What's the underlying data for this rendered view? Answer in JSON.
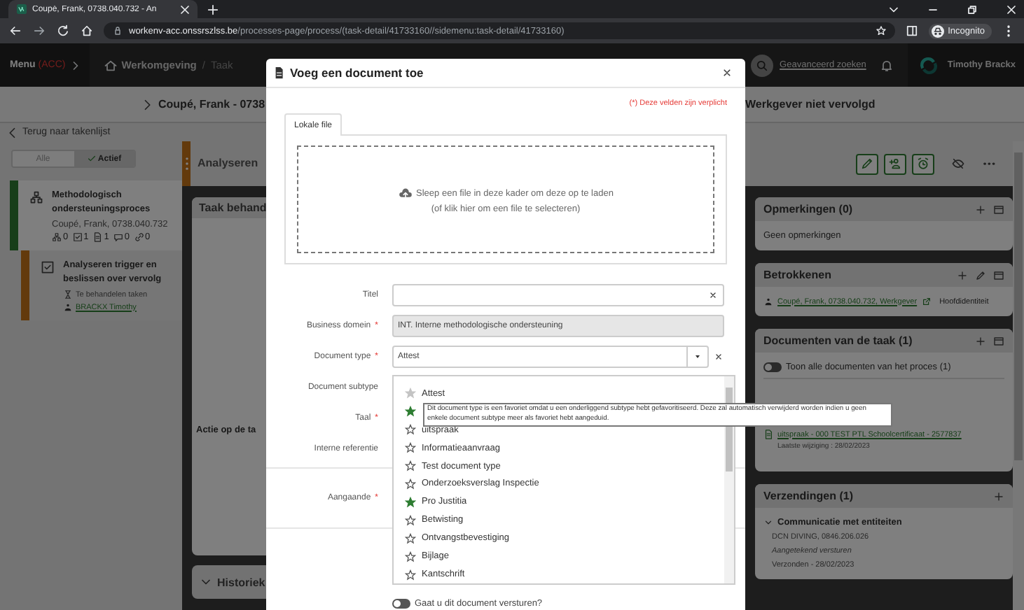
{
  "browser": {
    "tab_title": "Coupé, Frank, 0738.040.732 - An",
    "url_host": "workenv-acc.onssrszlss.be",
    "url_path": "/processes-page/process/(task-detail/41733160//sidemenu:task-detail/41733160)",
    "profile": "Incognito"
  },
  "app_header": {
    "menu": "Menu",
    "env": "(ACC)",
    "breadcrumbs": [
      {
        "label": "Werkomgeving"
      },
      {
        "label": "Taak"
      }
    ],
    "separator": "/",
    "advanced_search": "Geavanceerd zoeken",
    "user": "Timothy Brackx"
  },
  "title_bar": {
    "left": "Coupé, Frank - 0738",
    "right": "Werkgever niet vervolgd"
  },
  "back_link": "Terug naar takenlijst",
  "filter": [
    {
      "label": "Alle",
      "selected": false
    },
    {
      "label": "Actief",
      "selected": true
    }
  ],
  "process": {
    "title": "Methodologisch ondersteuningsproces",
    "subtitle": "Coupé, Frank, 0738.040.732",
    "counts": [
      {
        "kind": "hierarchy",
        "value": "0"
      },
      {
        "kind": "check",
        "value": "1"
      },
      {
        "kind": "document",
        "value": "1"
      },
      {
        "kind": "comment",
        "value": "0"
      },
      {
        "kind": "link",
        "value": "0"
      }
    ]
  },
  "task": {
    "title": "Analyseren trigger en beslissen over vervolg",
    "status": "Te behandelen taken",
    "assignee": "BRACKX Timothy"
  },
  "middle": {
    "header": "Analyseren",
    "section": "Taak behand",
    "action": "Actie op de ta",
    "history": "Historiek"
  },
  "panels": [
    {
      "kind": "remarks",
      "title": "Opmerkingen (0)",
      "empty": "Geen opmerkingen"
    },
    {
      "kind": "involved",
      "title": "Betrokkenen",
      "link": "Coupé, Frank, 0738.040.732, Werkgever",
      "role": "Hoofdidentiteit"
    },
    {
      "kind": "documents",
      "title": "Documenten van de taak (1)",
      "toggle": {
        "label": "Toon alle documenten van het proces (1)",
        "on": false
      },
      "document": "uitspraak - 000 TEST PTL Schoolcertificaat - 2577837",
      "modified": "Laatste wijziging : 28/02/2023"
    },
    {
      "kind": "shipments",
      "title": "Verzendingen (1)",
      "group": "Communicatie met entiteiten",
      "recipient": "DCN DIVING, 0846.206.026",
      "method": "Aangetekend versturen",
      "sent": "Verzonden - 28/02/2023"
    }
  ],
  "modal": {
    "title": "Voeg een document toe",
    "required_note": "(*) Deze velden zijn verplicht",
    "required_mark": "*",
    "tab": "Lokale file",
    "drop_line1": "Sleep een file in deze kader om deze op te laden",
    "drop_line2": "(of klik hier om een file te selecteren)",
    "fields": [
      {
        "kind": "text",
        "label": "Titel",
        "required": false
      },
      {
        "kind": "readonly",
        "label": "Business domein",
        "required": true,
        "value": "INT. Interne methodologische ondersteuning"
      },
      {
        "kind": "select",
        "label": "Document type",
        "required": true,
        "value": "Attest"
      },
      {
        "kind": "hidden",
        "label": "Document subtype",
        "required": false
      },
      {
        "kind": "hidden",
        "label": "Taal",
        "required": true
      },
      {
        "kind": "hidden",
        "label": "Interne referentie",
        "required": false
      },
      {
        "kind": "area",
        "label": "Aangaande",
        "required": true
      }
    ],
    "send_toggle": {
      "label": "Gaat u dit document versturen?",
      "on": false
    }
  },
  "dropdown": [
    {
      "label": "Attest",
      "selected": true,
      "favorite": false
    },
    {
      "selected": false,
      "favorite": true
    },
    {
      "label": "uitspraak",
      "selected": false,
      "favorite": false
    },
    {
      "label": "Informatieaanvraag",
      "selected": false,
      "favorite": false
    },
    {
      "label": "Test document type",
      "selected": false,
      "favorite": false
    },
    {
      "label": "Onderzoeksverslag Inspectie",
      "selected": false,
      "favorite": false
    },
    {
      "label": "Pro Justitia",
      "selected": false,
      "favorite": true
    },
    {
      "label": "Betwisting",
      "selected": false,
      "favorite": false
    },
    {
      "label": "Ontvangstbevestiging",
      "selected": false,
      "favorite": false
    },
    {
      "label": "Bijlage",
      "selected": false,
      "favorite": false
    },
    {
      "label": "Kantschrift",
      "selected": false,
      "favorite": false
    }
  ],
  "tooltip": "Dit document type is een favoriet omdat u een onderliggend subtype hebt gefavoritiseerd. Deze zal automatisch verwijderd worden indien u geen enkele document subtype meer als favoriet hebt aangeduid."
}
